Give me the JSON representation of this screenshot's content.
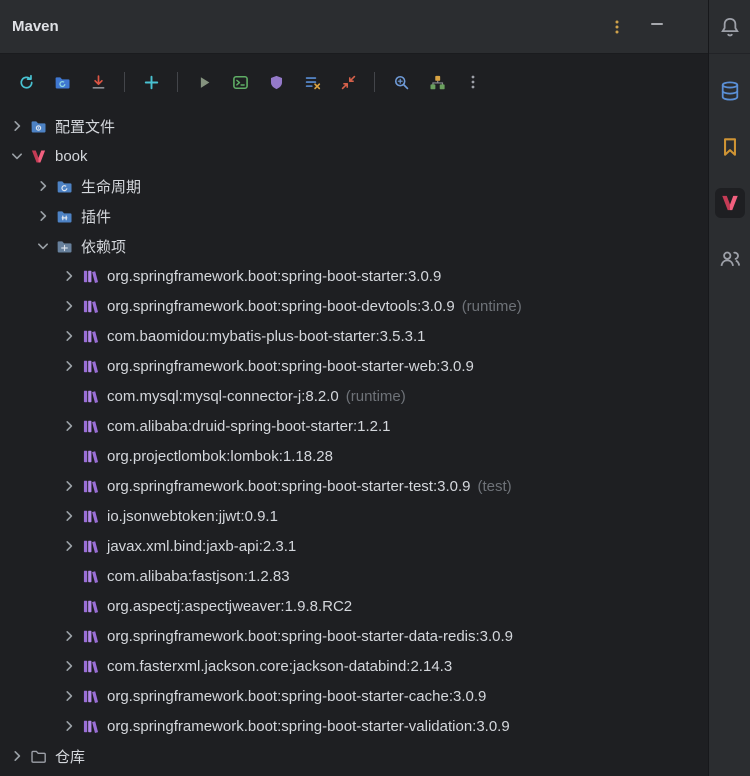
{
  "window": {
    "title": "Maven"
  },
  "titlebar": {
    "icons": [
      "more-options-kebab",
      "hide-tool-window-minimize"
    ]
  },
  "toolbar": {
    "icons": [
      "reload-all-maven-projects",
      "generate-sources-and-update-folders",
      "download-sources-documentation",
      "add-maven-project",
      "run-maven-build",
      "execute-maven-goal",
      "skip-tests-mode",
      "toggle-offline-mode",
      "collapse-all",
      "search-dependencies",
      "show-dependencies-diagram",
      "more-actions-kebab"
    ]
  },
  "stripe": {
    "icons": [
      "notifications-bell",
      "database",
      "bookmarks",
      "maven-tool-window",
      "collaboration-users"
    ],
    "selected": "maven-tool-window"
  },
  "colors": {
    "background": "#1e1f22",
    "panel": "#2b2d30",
    "tree_text": "#d4d7dc",
    "scope_text": "#6e7278",
    "maven_red": "#e8455a",
    "library_purple": "#a578de",
    "folder_blue": "#4d82c4",
    "accent_cyan": "#49c2d2"
  },
  "tree": {
    "items": [
      {
        "label": "配置文件",
        "icon": "folder-profiles",
        "state": "collapsed",
        "level": 0
      },
      {
        "label": "book",
        "icon": "maven-project",
        "state": "expanded",
        "level": 0
      },
      {
        "label": "生命周期",
        "icon": "folder-lifecycle",
        "state": "collapsed",
        "level": 1
      },
      {
        "label": "插件",
        "icon": "folder-plugins",
        "state": "collapsed",
        "level": 1
      },
      {
        "label": "依赖项",
        "icon": "folder-dependencies",
        "state": "expanded",
        "level": 1
      },
      {
        "label": "org.springframework.boot:spring-boot-starter:3.0.9",
        "icon": "library",
        "state": "collapsed",
        "level": 2
      },
      {
        "label": "org.springframework.boot:spring-boot-devtools:3.0.9",
        "scope": "(runtime)",
        "icon": "library",
        "state": "collapsed",
        "level": 2
      },
      {
        "label": "com.baomidou:mybatis-plus-boot-starter:3.5.3.1",
        "icon": "library",
        "state": "collapsed",
        "level": 2
      },
      {
        "label": "org.springframework.boot:spring-boot-starter-web:3.0.9",
        "icon": "library",
        "state": "collapsed",
        "level": 2
      },
      {
        "label": "com.mysql:mysql-connector-j:8.2.0",
        "scope": "(runtime)",
        "icon": "library",
        "state": "leaf",
        "level": 2
      },
      {
        "label": "com.alibaba:druid-spring-boot-starter:1.2.1",
        "icon": "library",
        "state": "collapsed",
        "level": 2
      },
      {
        "label": "org.projectlombok:lombok:1.18.28",
        "icon": "library",
        "state": "leaf",
        "level": 2
      },
      {
        "label": "org.springframework.boot:spring-boot-starter-test:3.0.9",
        "scope": "(test)",
        "icon": "library",
        "state": "collapsed",
        "level": 2
      },
      {
        "label": "io.jsonwebtoken:jjwt:0.9.1",
        "icon": "library",
        "state": "collapsed",
        "level": 2
      },
      {
        "label": "javax.xml.bind:jaxb-api:2.3.1",
        "icon": "library",
        "state": "collapsed",
        "level": 2
      },
      {
        "label": "com.alibaba:fastjson:1.2.83",
        "icon": "library",
        "state": "leaf",
        "level": 2
      },
      {
        "label": "org.aspectj:aspectjweaver:1.9.8.RC2",
        "icon": "library",
        "state": "leaf",
        "level": 2
      },
      {
        "label": "org.springframework.boot:spring-boot-starter-data-redis:3.0.9",
        "icon": "library",
        "state": "collapsed",
        "level": 2
      },
      {
        "label": "com.fasterxml.jackson.core:jackson-databind:2.14.3",
        "icon": "library",
        "state": "collapsed",
        "level": 2
      },
      {
        "label": "org.springframework.boot:spring-boot-starter-cache:3.0.9",
        "icon": "library",
        "state": "collapsed",
        "level": 2
      },
      {
        "label": "org.springframework.boot:spring-boot-starter-validation:3.0.9",
        "icon": "library",
        "state": "collapsed",
        "level": 2
      },
      {
        "label": "仓库",
        "icon": "folder-repositories",
        "state": "collapsed",
        "level": 0
      }
    ]
  }
}
